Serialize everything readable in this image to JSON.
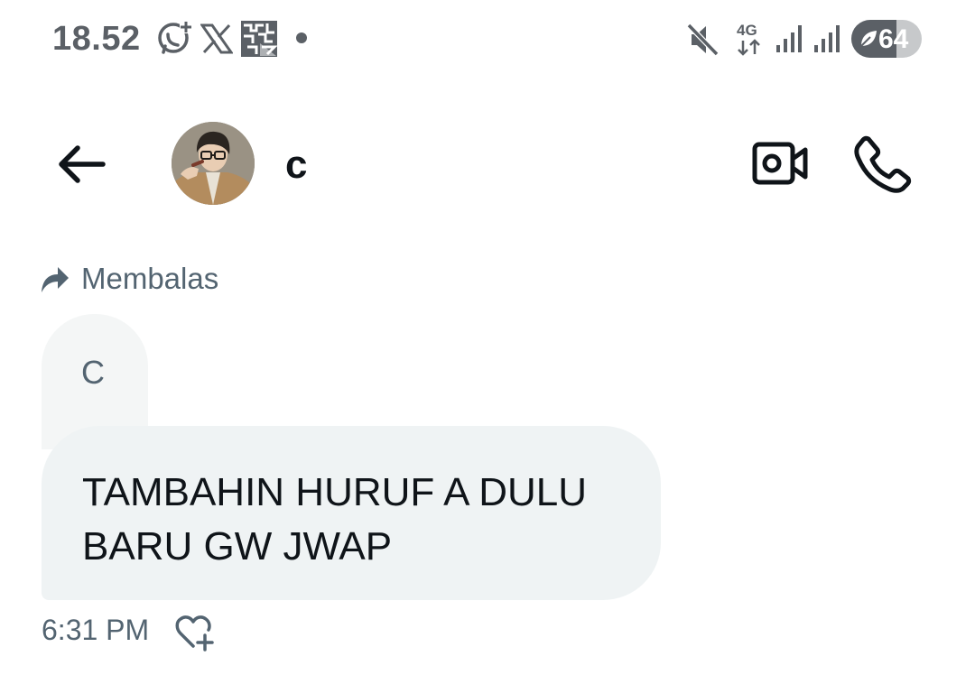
{
  "status_bar": {
    "time": "18.52",
    "network_type": "4G",
    "battery_level": "64",
    "battery_fraction": 0.64,
    "icons": [
      "whatsapp-plus-icon",
      "x-logo-icon",
      "app-icon",
      "notification-dot",
      "mute-icon",
      "network-4g-icon",
      "signal-icon",
      "signal-icon",
      "battery-saver-icon"
    ]
  },
  "header": {
    "contact_name": "c",
    "icons": [
      "back-arrow-icon",
      "avatar",
      "video-call-icon",
      "phone-call-icon"
    ]
  },
  "conversation": {
    "reply_label": "Membalas",
    "quoted_message": "C",
    "message_text": "TAMBAHIN HURUF A DULU BARU GW JWAP",
    "message_time": "6:31 PM"
  },
  "colors": {
    "background": "#ffffff",
    "bubble": "#eff3f4",
    "quoted_bubble": "#f4f6f6",
    "secondary_text": "#536471",
    "primary_text": "#0f1419",
    "status_text": "#5b6066"
  }
}
